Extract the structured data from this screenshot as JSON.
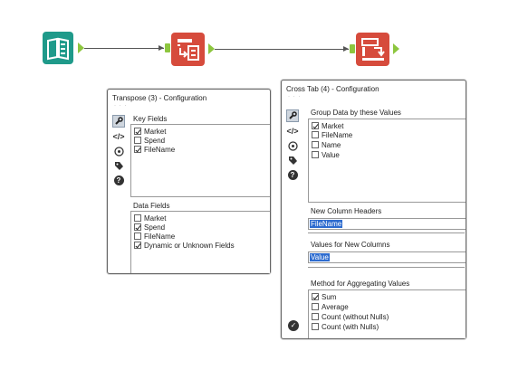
{
  "canvas": {
    "tools": [
      "input-data-tool",
      "transpose-tool",
      "cross-tab-tool"
    ]
  },
  "transpose_panel": {
    "title": "Transpose (3) - Configuration",
    "dots": "· · ·",
    "key_fields_label": "Key Fields",
    "key_fields": [
      {
        "label": "Market",
        "checked": true
      },
      {
        "label": "Spend",
        "checked": false
      },
      {
        "label": "FileName",
        "checked": true
      }
    ],
    "data_fields_label": "Data Fields",
    "data_fields": [
      {
        "label": "Market",
        "checked": false
      },
      {
        "label": "Spend",
        "checked": true
      },
      {
        "label": "FileName",
        "checked": false
      },
      {
        "label": "Dynamic or Unknown Fields",
        "checked": true
      }
    ],
    "rail_icons": [
      "wrench-icon",
      "code-icon",
      "globe-icon",
      "tag-icon",
      "help-icon"
    ]
  },
  "crosstab_panel": {
    "title": "Cross Tab (4) - Configuration",
    "dots": "· · ·",
    "group_label": "Group Data by these Values",
    "group_fields": [
      {
        "label": "Market",
        "checked": true
      },
      {
        "label": "FileName",
        "checked": false
      },
      {
        "label": "Name",
        "checked": false
      },
      {
        "label": "Value",
        "checked": false
      }
    ],
    "new_headers_label": "New Column Headers",
    "new_headers_value": "FileName",
    "values_label": "Values for New Columns",
    "values_value": "Value",
    "method_label": "Method for Aggregating Values",
    "methods": [
      {
        "label": "Sum",
        "checked": true
      },
      {
        "label": "Average",
        "checked": false
      },
      {
        "label": "Count (without Nulls)",
        "checked": false
      },
      {
        "label": "Count (with Nulls)",
        "checked": false
      }
    ],
    "rail_icons": [
      "wrench-icon",
      "code-icon",
      "globe-icon",
      "tag-icon",
      "help-icon"
    ],
    "ok_icon": "checkmark-icon"
  }
}
